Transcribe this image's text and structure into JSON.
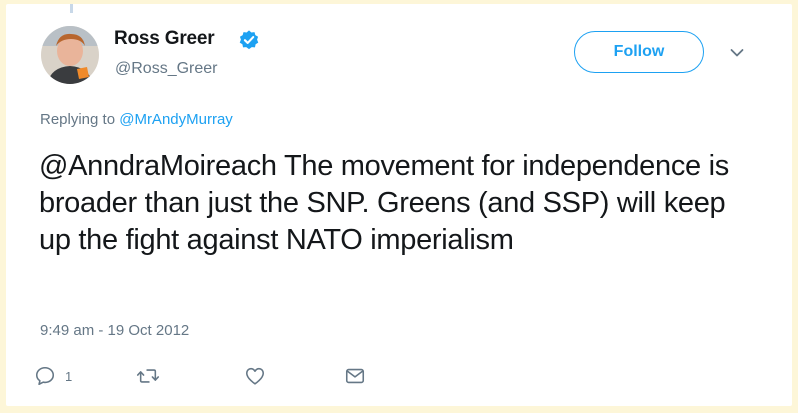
{
  "tweet": {
    "author_name": "Ross Greer",
    "author_handle": "@Ross_Greer",
    "follow_label": "Follow",
    "replying_prefix": "Replying to ",
    "replying_to": "@MrAndyMurray",
    "text": "@AnndraMoireach The movement for independence is broader than just the SNP. Greens (and SSP) will keep up the fight against NATO imperialism",
    "timestamp": "9:49 am - 19 Oct 2012",
    "reply_count": "1"
  },
  "icons": {
    "verified": "verified-badge-icon",
    "more": "chevron-down-icon",
    "reply": "reply-icon",
    "retweet": "retweet-icon",
    "like": "heart-icon",
    "message": "envelope-icon"
  },
  "colors": {
    "accent": "#1da1f2",
    "text": "#14171a",
    "muted": "#657786",
    "background": "#fdf6d8"
  }
}
